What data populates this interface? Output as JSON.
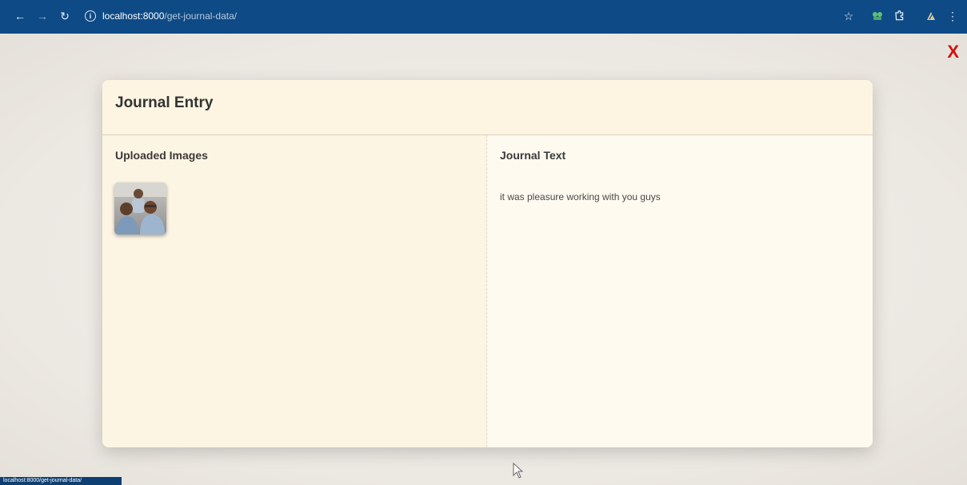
{
  "browser": {
    "url_host": "localhost:8000",
    "url_path": "/get-journal-data/",
    "status_link": "localhost:8000/get-journal-data/"
  },
  "modal": {
    "title": "Journal Entry",
    "close_label": "X",
    "images_heading": "Uploaded Images",
    "text_heading": "Journal Text",
    "journal_text": "it was pleasure working with you guys"
  },
  "colors": {
    "browser_bar": "#0e4a85",
    "close": "#d21212",
    "modal_bg": "#fdf7e8"
  }
}
